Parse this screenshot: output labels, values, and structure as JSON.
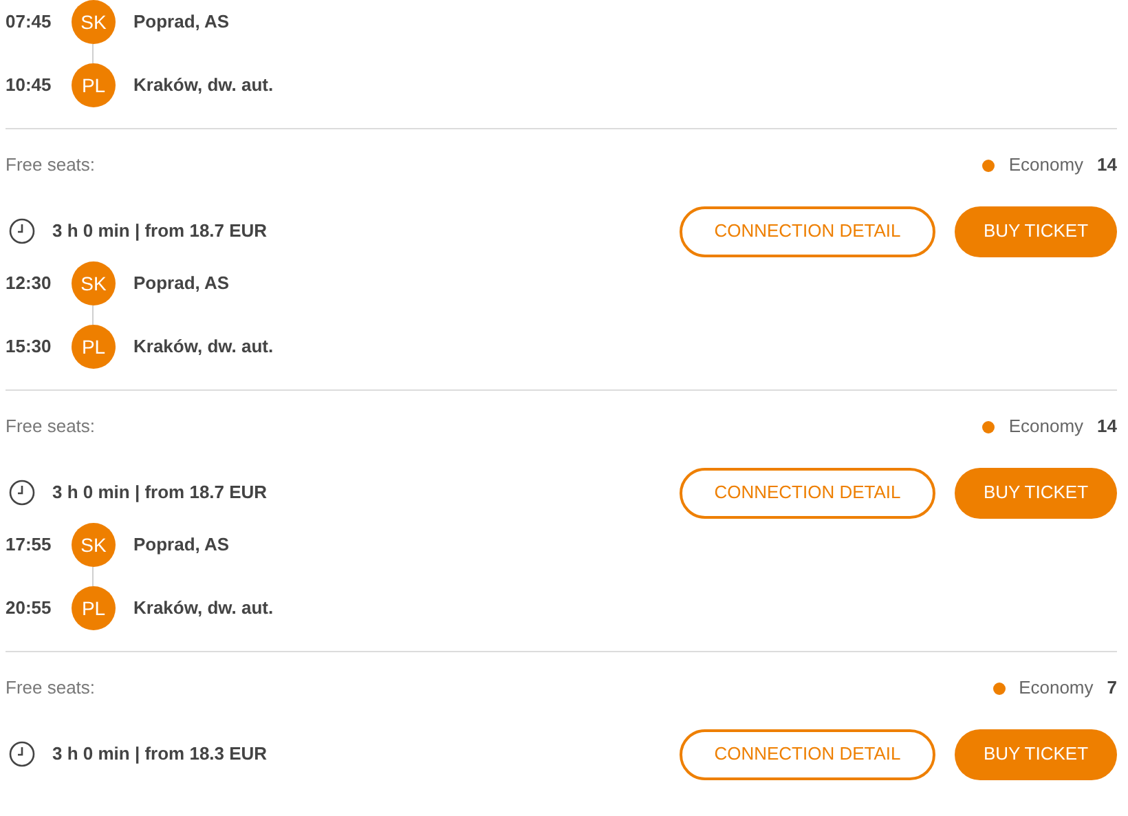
{
  "connections": [
    {
      "stops": [
        {
          "time": "07:45",
          "country": "SK",
          "station": "Poprad, AS"
        },
        {
          "time": "10:45",
          "country": "PL",
          "station": "Kraków, dw. aut."
        }
      ],
      "seats_label": "Free seats:",
      "seat_classes": [
        {
          "name": "Economy",
          "count": "14",
          "color": "#ee7f00"
        }
      ],
      "summary": "3 h 0 min | from 18.7 EUR",
      "detail_button": "CONNECTION DETAIL",
      "buy_button": "BUY TICKET"
    },
    {
      "stops": [
        {
          "time": "12:30",
          "country": "SK",
          "station": "Poprad, AS"
        },
        {
          "time": "15:30",
          "country": "PL",
          "station": "Kraków, dw. aut."
        }
      ],
      "seats_label": "Free seats:",
      "seat_classes": [
        {
          "name": "Economy",
          "count": "14",
          "color": "#ee7f00"
        }
      ],
      "summary": "3 h 0 min | from 18.7 EUR",
      "detail_button": "CONNECTION DETAIL",
      "buy_button": "BUY TICKET"
    },
    {
      "stops": [
        {
          "time": "17:55",
          "country": "SK",
          "station": "Poprad, AS"
        },
        {
          "time": "20:55",
          "country": "PL",
          "station": "Kraków, dw. aut."
        }
      ],
      "seats_label": "Free seats:",
      "seat_classes": [
        {
          "name": "Economy",
          "count": "7",
          "color": "#ee7f00"
        }
      ],
      "summary": "3 h 0 min | from 18.3 EUR",
      "detail_button": "CONNECTION DETAIL",
      "buy_button": "BUY TICKET"
    }
  ]
}
